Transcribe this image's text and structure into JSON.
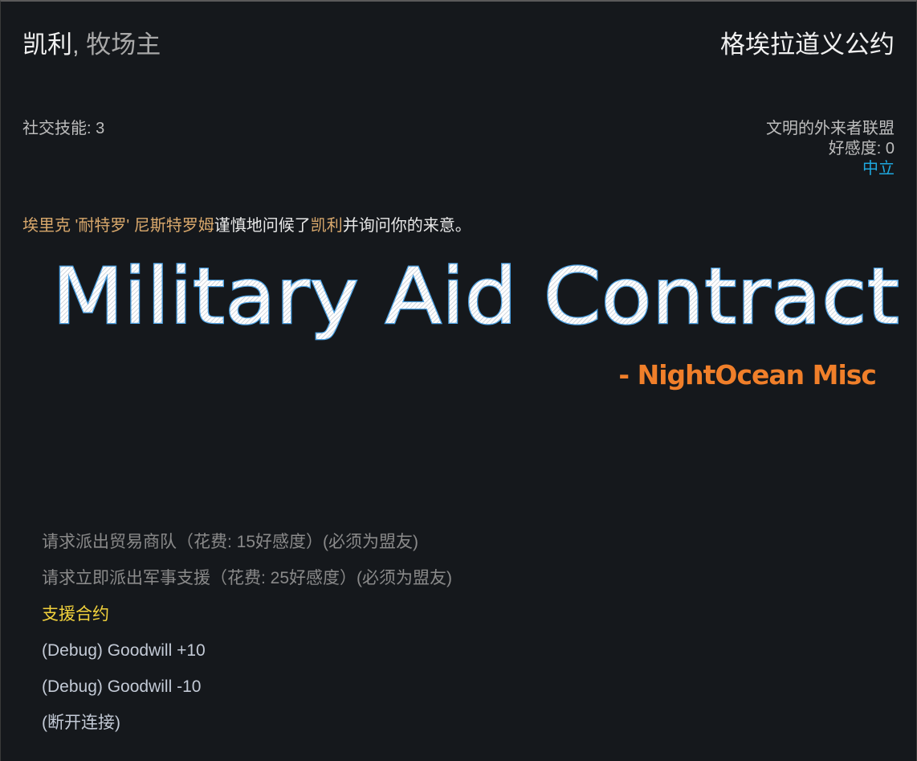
{
  "header": {
    "negotiator_name": "凯利",
    "separator": ",",
    "negotiator_title": "牧场主",
    "faction_name": "格埃拉道义公约"
  },
  "stats": {
    "social_skill": "社交技能: 3"
  },
  "faction_info": {
    "kind": "文明的外来者联盟",
    "goodwill": "好感度: 0",
    "relation": "中立",
    "relation_color": "#1ea9e0"
  },
  "greeting": {
    "leader_name": "埃里克 '耐特罗' 尼斯特罗姆",
    "verb": "谨慎地问候了",
    "negotiator": "凯利",
    "rest": "并询问你的来意。"
  },
  "banner": {
    "title": "Military Aid Contract",
    "signature": "- NightOcean Misc"
  },
  "options": [
    {
      "label": "请求派出贸易商队（花费: 15好感度）(必须为盟友)",
      "state": "disabled"
    },
    {
      "label": "请求立即派出军事支援（花费: 25好感度）(必须为盟友)",
      "state": "disabled"
    },
    {
      "label": "支援合约",
      "state": "highlight"
    },
    {
      "label": "(Debug) Goodwill +10",
      "state": "normal"
    },
    {
      "label": "(Debug) Goodwill -10",
      "state": "normal"
    },
    {
      "label": "(断开连接)",
      "state": "normal"
    }
  ],
  "colors": {
    "background": "#15181c",
    "highlight_name": "#d9a86c",
    "option_highlight": "#f2d23c",
    "banner_outline": "#4a9fe0",
    "signature": "#f07f2a"
  }
}
